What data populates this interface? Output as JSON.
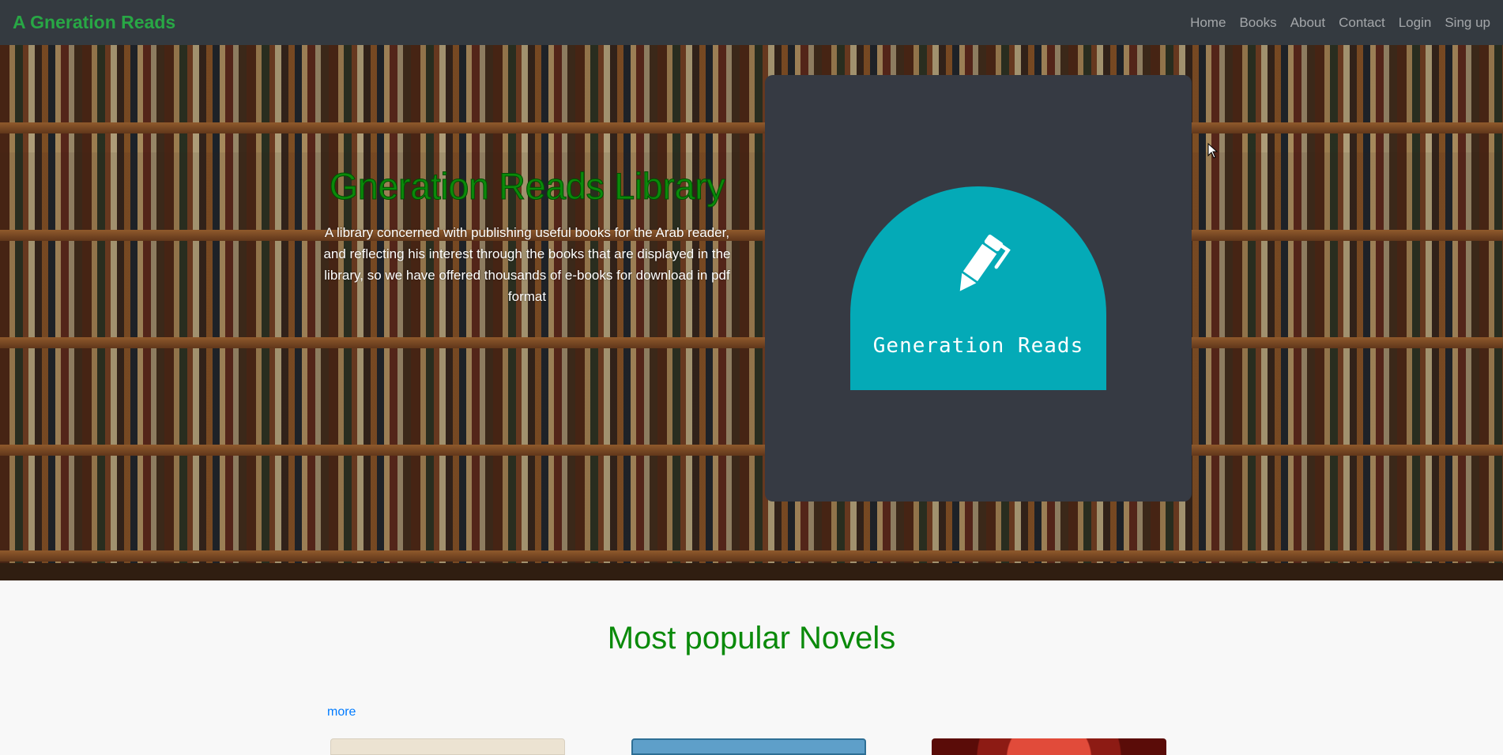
{
  "navbar": {
    "brand": "A Gneration Reads",
    "links": [
      "Home",
      "Books",
      "About",
      "Contact",
      "Login",
      "Sing up"
    ]
  },
  "hero": {
    "title": "Gneration Reads Library",
    "description": "A library concerned with publishing useful books for the Arab reader, and reflecting his interest through the books that are displayed in the library, so we have offered thousands of e-books for download in pdf format"
  },
  "logo": {
    "text": "Generation Reads",
    "badge_color": "#04aab7",
    "icon": "pen-icon"
  },
  "popular": {
    "title": "Most popular Novels",
    "more_label": "more"
  },
  "colors": {
    "accent_green": "#0a8a0a",
    "brand_green": "#28a745",
    "navbar_bg": "#343a40",
    "link_blue": "#007bff"
  }
}
